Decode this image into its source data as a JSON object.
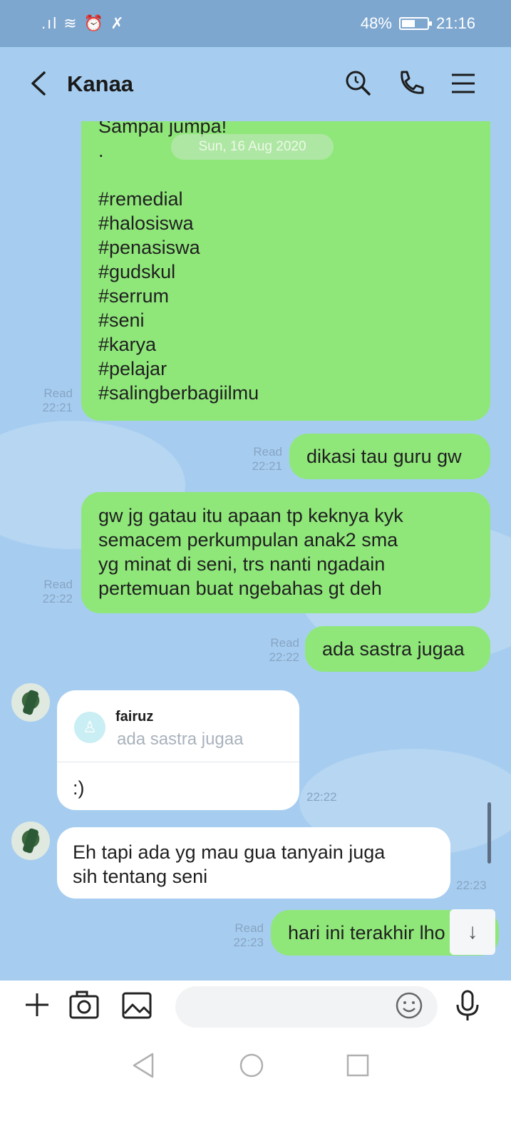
{
  "status": {
    "left_icons": ".ıl ≋ ⏰ ✗",
    "battery": "48%",
    "time": "21:16"
  },
  "header": {
    "title": "Kanaa",
    "icons": [
      "back-arrow",
      "search-icon",
      "phone-icon",
      "menu-icon"
    ]
  },
  "date_label": "Sun, 16 Aug 2020",
  "messages": [
    {
      "type": "sent",
      "read": "Read",
      "time": "22:21",
      "lines": [
        "Sampai jumpa!",
        ".",
        "",
        "#remedial",
        "#halosiswa",
        "#penasiswa",
        "#gudskul",
        "#serrum",
        "#seni",
        "#karya",
        "#pelajar",
        "#salingberbagiilmu"
      ]
    },
    {
      "type": "sent",
      "read": "Read",
      "time": "22:21",
      "lines": [
        "dikasi tau guru gw"
      ]
    },
    {
      "type": "sent",
      "read": "Read",
      "time": "22:22",
      "lines": [
        "gw jg gatau itu apaan tp keknya kyk",
        "semacem perkumpulan anak2 sma",
        "yg minat di seni, trs nanti ngadain",
        "pertemuan buat ngebahas gt deh"
      ]
    },
    {
      "type": "sent",
      "read": "Read",
      "time": "22:22",
      "lines": [
        "ada sastra jugaa"
      ]
    },
    {
      "type": "received_reply",
      "time": "22:22",
      "reply_name": "fairuz",
      "reply_text": "ada sastra jugaa",
      "lines": [
        ":)"
      ]
    },
    {
      "type": "received",
      "time": "22:23",
      "lines": [
        "Eh tapi ada yg mau gua tanyain juga",
        "sih tentang seni"
      ]
    },
    {
      "type": "sent",
      "read": "Read",
      "time": "22:23",
      "lines": [
        "hari ini terakhir lho"
      ]
    }
  ],
  "input": {
    "placeholder": "",
    "icons": [
      "plus-icon",
      "camera-icon",
      "image-icon",
      "emoji-icon",
      "mic-icon"
    ]
  },
  "nav": {
    "icons": [
      "back-triangle-icon",
      "home-circle-icon",
      "recents-square-icon"
    ]
  },
  "colors": {
    "chat_bg": "#a6cdf0",
    "sent_bubble": "#8fe77a",
    "received_bubble": "#ffffff",
    "status_bar": "#7ea7cf"
  }
}
